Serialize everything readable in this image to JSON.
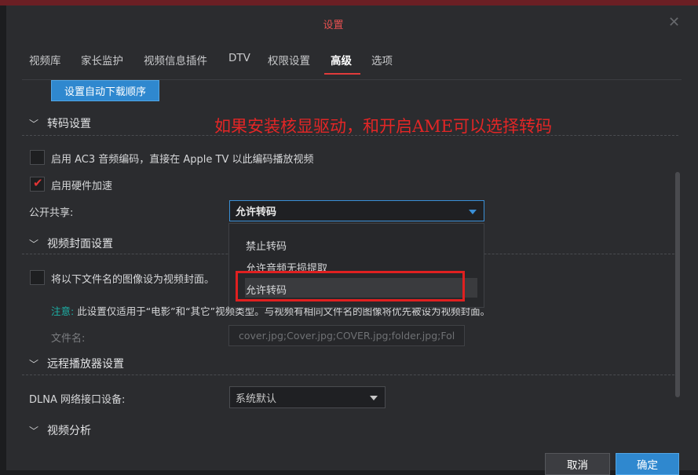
{
  "dialog": {
    "title": "设置",
    "close_icon": "close-icon"
  },
  "tabs": [
    {
      "label": "视频库"
    },
    {
      "label": "家长监护"
    },
    {
      "label": "视频信息插件"
    },
    {
      "label": "DTV"
    },
    {
      "label": "权限设置"
    },
    {
      "label": "高级",
      "active": true
    },
    {
      "label": "选项"
    }
  ],
  "download_order_button": "设置自动下载顺序",
  "annotation_text": "如果安装核显驱动，和开启AME可以选择转码",
  "transcode": {
    "section_title": "转码设置",
    "ac3_label": "启用 AC3 音频编码，直接在 Apple TV 以此编码播放视频",
    "ac3_checked": false,
    "hw_accel_label": "启用硬件加速",
    "hw_accel_checked": true,
    "public_share_label": "公开共享:",
    "public_share_value": "允许转码",
    "options": [
      "禁止转码",
      "允许音频无损提取",
      "允许转码"
    ]
  },
  "cover": {
    "section_title": "视频封面设置",
    "checkbox_label": "将以下文件名的图像设为视频封面。",
    "checked": false,
    "note_key": "注意:",
    "note_text": "此设置仅适用于“电影”和“其它”视频类型。与视频有相同文件名的图像将优先被设为视频封面。",
    "filename_label": "文件名:",
    "filename_value": "cover.jpg;Cover.jpg;COVER.jpg;folder.jpg;Fol"
  },
  "remote": {
    "section_title": "远程播放器设置",
    "dlna_label": "DLNA 网络接口设备:",
    "dlna_value": "系统默认"
  },
  "analysis": {
    "section_title": "视频分析"
  },
  "footer": {
    "cancel": "取消",
    "ok": "确定"
  },
  "colors": {
    "accent": "#2f88cf",
    "title_red": "#e65050",
    "annotation_red": "#e32626",
    "note_teal": "#1cb0a6"
  }
}
